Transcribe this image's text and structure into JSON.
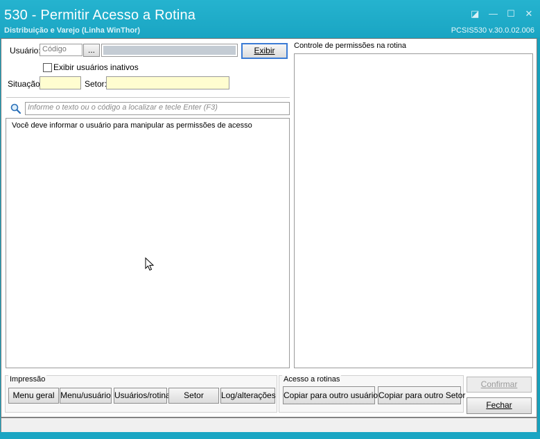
{
  "window": {
    "title": "530 - Permitir Acesso a Rotina",
    "subtitle": "Distribuição e Varejo (Linha WinThor)",
    "version": "PCSIS530  v.30.0.02.006",
    "controls": [
      "◪",
      "—",
      "☐",
      "✕"
    ]
  },
  "form": {
    "usuario_label": "Usuário:",
    "usuario_code_placeholder": "Código",
    "lookup_label": "...",
    "exibir_label": "Exibir",
    "inativos_label": "Exibir usuários inativos",
    "situacao_label": "Situação:",
    "setor_label": "Setor:"
  },
  "search": {
    "placeholder": "Informe o texto ou o código a localizar e tecle Enter (F3)"
  },
  "list": {
    "message": "Você deve informar o usuário para manipular as permissões de acesso"
  },
  "right_panel": {
    "title": "Controle de permissões na rotina"
  },
  "impressao": {
    "title": "Impressão",
    "buttons": [
      "Menu geral",
      "Menu/usuário",
      "Usuários/rotina",
      "Setor",
      "Log/alterações"
    ]
  },
  "acesso": {
    "title": "Acesso a rotinas",
    "buttons": [
      "Copiar para outro usuário",
      "Copiar para outro Setor"
    ]
  },
  "actions": {
    "confirmar": "Confirmar",
    "fechar": "Fechar"
  },
  "colors": {
    "titlebar": "#1aa5c3",
    "field_yellow": "#fffdd0",
    "accent_border": "#3a7bd5"
  }
}
